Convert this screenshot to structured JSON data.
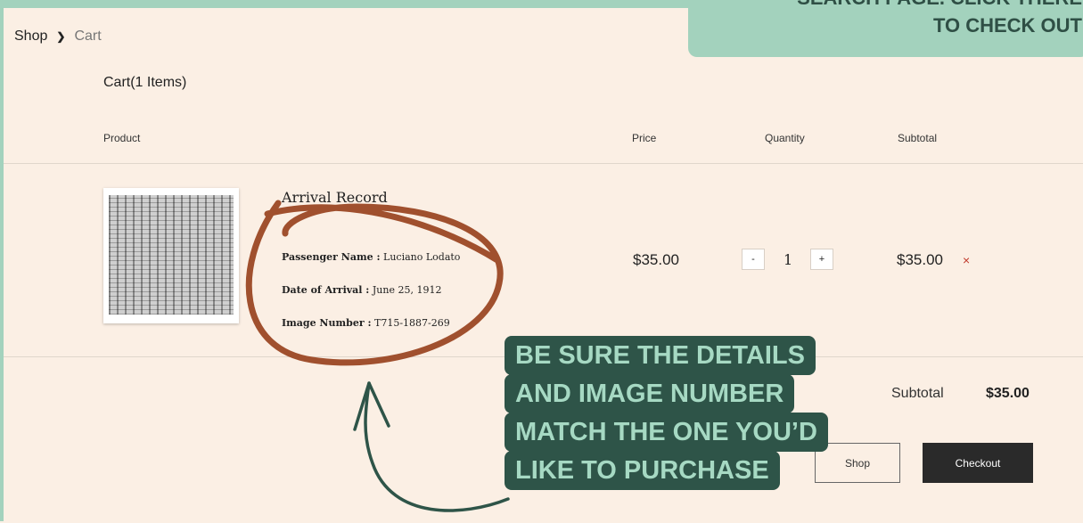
{
  "breadcrumb": {
    "shop": "Shop",
    "current": "Cart"
  },
  "cart": {
    "title": "Cart(1 Items)"
  },
  "columns": {
    "product": "Product",
    "price": "Price",
    "quantity": "Quantity",
    "subtotal": "Subtotal"
  },
  "item": {
    "name": "Arrival Record",
    "passenger_label": "Passenger Name :",
    "passenger_value": "Luciano Lodato",
    "arrival_label": "Date of Arrival :",
    "arrival_value": "June 25, 1912",
    "image_label": "Image Number :",
    "image_value": "T715-1887-269",
    "price": "$35.00",
    "quantity": "1",
    "minus": "-",
    "plus": "+",
    "subtotal": "$35.00",
    "remove": "×"
  },
  "totals": {
    "label": "Subtotal",
    "value": "$35.00"
  },
  "buttons": {
    "shop": "Shop",
    "checkout": "Checkout"
  },
  "annotations": {
    "top_line1": "SEARCH PAGE. CLICK THERE",
    "top_line2": "TO CHECK OUT",
    "callout": [
      "BE SURE THE DETAILS",
      "AND IMAGE NUMBER",
      "MATCH THE ONE YOU’D",
      "LIKE TO PURCHASE"
    ]
  },
  "colors": {
    "accent": "#a3d2bd",
    "callout_bg": "#2e5448",
    "callout_text": "#a6d9c3",
    "marker": "#a0502e"
  }
}
